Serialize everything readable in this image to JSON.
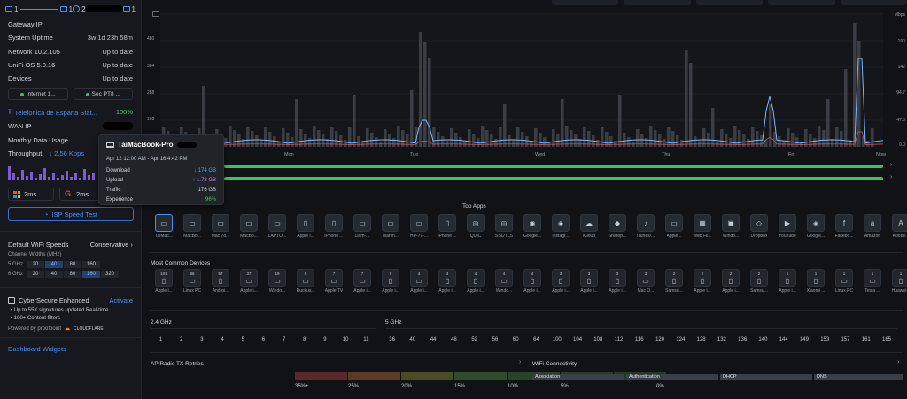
{
  "topology": {
    "a": "1",
    "b": "1",
    "c": "2",
    "d": "1"
  },
  "sidebar": {
    "rows": [
      {
        "label": "Gateway IP",
        "value": ""
      },
      {
        "label": "System Uptime",
        "value": "3w 1d 23h 58m"
      },
      {
        "label": "Network 10.2.105",
        "value": "Up to date"
      },
      {
        "label": "UniFi OS 5.0.16",
        "value": "Up to date"
      },
      {
        "label": "Devices",
        "value": "Up to date"
      }
    ],
    "pills": [
      "Internet 1...",
      "Sec PT8 ..."
    ],
    "isp": {
      "name": "Telefonica de Espana Stat...",
      "pct": "100%"
    },
    "wan_ip": "WAN IP",
    "monthly": "Monthly Data Usage",
    "throughput": {
      "label": "Throughput",
      "value": "↓ 2.56 Kbps"
    },
    "latency": [
      {
        "value": "2ms"
      },
      {
        "value": "2ms"
      }
    ],
    "speed_test": "ISP Speed Test",
    "wifi": {
      "label": "Default WiFi Speeds",
      "value": "Conservative ›"
    },
    "channel_widths_label": "Channel Widths (MHz)",
    "cw_rows": [
      {
        "band": "5 GHz",
        "cells": [
          "20",
          "40",
          "80",
          "160"
        ],
        "sel": 1
      },
      {
        "band": "6 GHz",
        "cells": [
          "20",
          "40",
          "80",
          "160",
          "320"
        ],
        "sel": 3
      }
    ],
    "cybersecure": {
      "label": "CyberSecure Enhanced",
      "action": "Activate"
    },
    "cs_bullets": [
      "•  Up to 55K signatures updated Real-time.",
      "•  100+ Content filters"
    ],
    "powered": {
      "label": "Powered by proofpoint",
      "brand": "CLOUDFLARE"
    },
    "dashboard_widgets": "Dashboard Widgets"
  },
  "chart": {
    "y_left": [
      "480",
      "384",
      "288",
      "192",
      "96"
    ],
    "y_right_unit": "Mbps",
    "y_right": [
      "190",
      "142",
      "94.7",
      "47.5",
      "0.0"
    ],
    "x": [
      "Mon",
      "Tue",
      "Wed",
      "Thu",
      "Fri",
      "Now"
    ]
  },
  "tooltip": {
    "title": "TaiMacBook-Pro",
    "date": "Apr 12 12:00 AM - Apr 16 4:42 PM",
    "rows": [
      {
        "label": "Download",
        "value": "↓ 174 GB"
      },
      {
        "label": "Upload",
        "value": "↑ 1.73 GB"
      },
      {
        "label": "Traffic",
        "value": "176 GB"
      },
      {
        "label": "Experience",
        "value": "96%"
      }
    ]
  },
  "top_apps": {
    "title": "Top Apps",
    "items": [
      "TaiMac...",
      "MacBo...",
      "Mac 7d...",
      "MacBo...",
      "LAPTO...",
      "Apple i...",
      "iPhone ...",
      "Liam-...",
      "Martin...",
      "HP-77-...",
      "iPhone ...",
      "QUIC",
      "SSL/TLS",
      "Google...",
      "Instagr...",
      "iCloud",
      "Sharep...",
      "iTunes/...",
      "Apple...",
      "Web Fil...",
      "Windo...",
      "Dropbox",
      "YouTube",
      "Google...",
      "Facebo...",
      "Amazon",
      "Adobe..."
    ]
  },
  "devices": {
    "title": "Most Common Devices",
    "items": [
      {
        "n": "101",
        "c": "Apple i..."
      },
      {
        "n": "86",
        "c": "Linux PC"
      },
      {
        "n": "57",
        "c": "Androi..."
      },
      {
        "n": "37",
        "c": "Apple i..."
      },
      {
        "n": "19",
        "c": "Windo..."
      },
      {
        "n": "9",
        "c": "Ruckus..."
      },
      {
        "n": "7",
        "c": "Apple TV"
      },
      {
        "n": "7",
        "c": "Apple i..."
      },
      {
        "n": "6",
        "c": "Apple i..."
      },
      {
        "n": "4",
        "c": "Apple i..."
      },
      {
        "n": "4",
        "c": "Apple i..."
      },
      {
        "n": "4",
        "c": "Apple i..."
      },
      {
        "n": "4",
        "c": "Windo..."
      },
      {
        "n": "4",
        "c": "Apple i..."
      },
      {
        "n": "3",
        "c": "Apple i..."
      },
      {
        "n": "3",
        "c": "Apple i..."
      },
      {
        "n": "3",
        "c": "Apple i..."
      },
      {
        "n": "3",
        "c": "Mac O..."
      },
      {
        "n": "2",
        "c": "Samsu..."
      },
      {
        "n": "2",
        "c": "Apple i..."
      },
      {
        "n": "2",
        "c": "Apple i..."
      },
      {
        "n": "2",
        "c": "Samsu..."
      },
      {
        "n": "1",
        "c": "Apple i..."
      },
      {
        "n": "1",
        "c": "Xiaomi ..."
      },
      {
        "n": "1",
        "c": "Linux PC"
      },
      {
        "n": "1",
        "c": "Tesla ..."
      },
      {
        "n": "1",
        "c": "Huawei..."
      }
    ]
  },
  "channels": {
    "g24": {
      "title": "2.4 GHz",
      "list": [
        "1",
        "2",
        "3",
        "4",
        "5",
        "6",
        "7",
        "8",
        "9",
        "10",
        "11"
      ]
    },
    "g5": {
      "title": "5 GHz",
      "list": [
        "36",
        "40",
        "44",
        "48",
        "52",
        "56",
        "60",
        "64",
        "100",
        "104",
        "108",
        "112",
        "116",
        "120",
        "124",
        "128",
        "132",
        "136",
        "140",
        "144",
        "149",
        "153",
        "157",
        "161",
        "165"
      ]
    }
  },
  "retries": {
    "title": "AP Radio TX Retries",
    "labels": [
      "35%+",
      "25%",
      "20%",
      "15%",
      "10%",
      "5%",
      "0%"
    ],
    "colors": [
      "#5a2a2a",
      "#5a3a24",
      "#4a4a24",
      "#2e4a2a",
      "#25442a",
      "#223f28",
      "#203a26"
    ]
  },
  "wifi_conn": {
    "title": "WiFi Connectivity",
    "steps": [
      "Association",
      "Authentication",
      "DHCP",
      "DNS"
    ]
  }
}
